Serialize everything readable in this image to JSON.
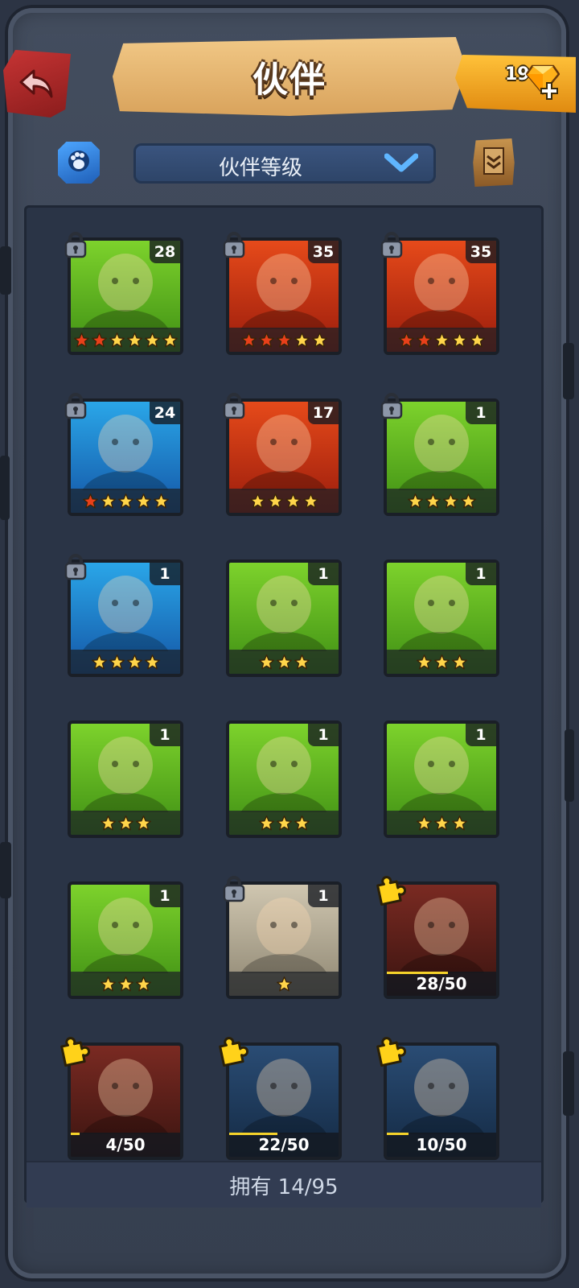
{
  "header": {
    "title": "伙伴",
    "gems": "19",
    "back_icon": "back-arrow-icon",
    "gem_icon": "diamond-icon",
    "plus_icon": "plus-icon"
  },
  "filter": {
    "sort_label": "伙伴等级",
    "left_icon": "paw-badge-icon",
    "right_icon": "scroll-icon"
  },
  "footer": {
    "owned_text": "拥有 14/95"
  },
  "colors": {
    "frame": "#434d5e",
    "panel": "#2a3446",
    "accent_gold": "#ffc23a",
    "back_red": "#c63434",
    "dropdown_blue": "#3b5580"
  },
  "heroes": [
    {
      "level": "28",
      "stars": 6,
      "red_stars": 2,
      "locked": true,
      "theme": "green"
    },
    {
      "level": "35",
      "stars": 5,
      "red_stars": 3,
      "locked": true,
      "theme": "red"
    },
    {
      "level": "35",
      "stars": 5,
      "red_stars": 2,
      "locked": true,
      "theme": "red"
    },
    {
      "level": "24",
      "stars": 5,
      "red_stars": 1,
      "locked": true,
      "theme": "blue"
    },
    {
      "level": "17",
      "stars": 4,
      "red_stars": 0,
      "locked": true,
      "theme": "red"
    },
    {
      "level": "1",
      "stars": 4,
      "red_stars": 0,
      "locked": true,
      "theme": "green"
    },
    {
      "level": "1",
      "stars": 4,
      "red_stars": 0,
      "locked": true,
      "theme": "blue"
    },
    {
      "level": "1",
      "stars": 3,
      "red_stars": 0,
      "locked": false,
      "theme": "green"
    },
    {
      "level": "1",
      "stars": 3,
      "red_stars": 0,
      "locked": false,
      "theme": "green"
    },
    {
      "level": "1",
      "stars": 3,
      "red_stars": 0,
      "locked": false,
      "theme": "green"
    },
    {
      "level": "1",
      "stars": 3,
      "red_stars": 0,
      "locked": false,
      "theme": "green"
    },
    {
      "level": "1",
      "stars": 3,
      "red_stars": 0,
      "locked": false,
      "theme": "green"
    },
    {
      "level": "1",
      "stars": 3,
      "red_stars": 0,
      "locked": false,
      "theme": "green"
    },
    {
      "level": "1",
      "stars": 1,
      "red_stars": 0,
      "locked": true,
      "theme": "gray"
    },
    {
      "shards": "28/50",
      "progress": 0.56,
      "theme": "dark-red"
    },
    {
      "shards": "4/50",
      "progress": 0.08,
      "theme": "dark-red"
    },
    {
      "shards": "22/50",
      "progress": 0.44,
      "theme": "dark-blue"
    },
    {
      "shards": "10/50",
      "progress": 0.2,
      "theme": "dark-blue"
    }
  ]
}
